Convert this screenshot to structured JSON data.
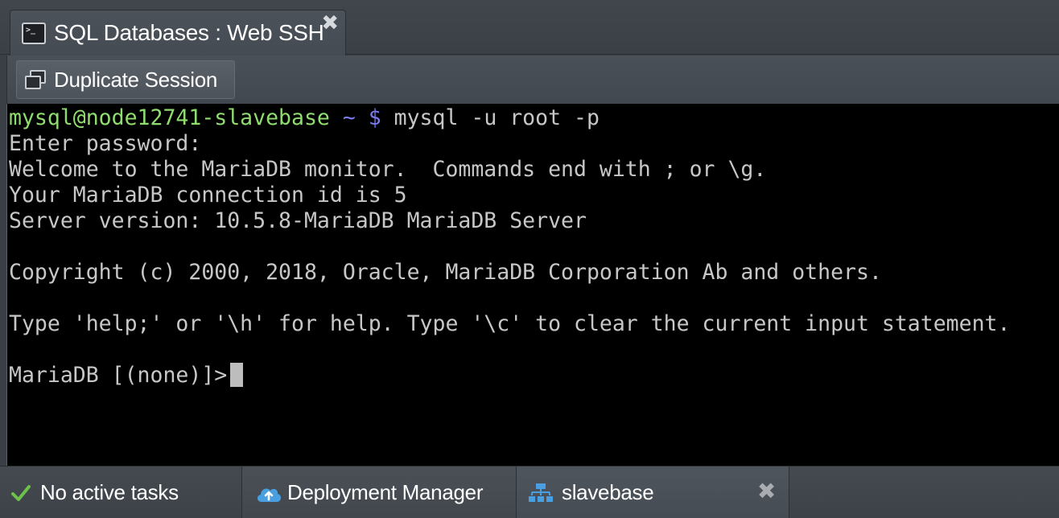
{
  "tab": {
    "title": "SQL Databases : Web SSH",
    "icon": "terminal-icon",
    "icon_glyph": ">_",
    "close_glyph": "✖"
  },
  "toolbar": {
    "duplicate_label": "Duplicate Session",
    "duplicate_icon": "duplicate-window-icon"
  },
  "terminal": {
    "prompt_user": "mysql@node12741-slavebase",
    "prompt_path": " ~ $",
    "command": " mysql -u root -p",
    "lines": [
      "Enter password:",
      "Welcome to the MariaDB monitor.  Commands end with ; or \\g.",
      "Your MariaDB connection id is 5",
      "Server version: 10.5.8-MariaDB MariaDB Server",
      "",
      "Copyright (c) 2000, 2018, Oracle, MariaDB Corporation Ab and others.",
      "",
      "Type 'help;' or '\\h' for help. Type '\\c' to clear the current input statement.",
      ""
    ],
    "db_prompt": "MariaDB [(none)]>",
    "colors": {
      "user": "#8fdc6f",
      "path": "#7c7cf0",
      "text": "#c7c7c7",
      "background": "#000000"
    }
  },
  "statusbar": {
    "tasks_label": "No active tasks",
    "tasks_icon": "check-icon",
    "deployment_label": "Deployment Manager",
    "deployment_icon": "cloud-upload-icon",
    "node_label": "slavebase",
    "node_icon": "environment-tree-icon",
    "close_glyph": "✖"
  },
  "colors": {
    "check": "#6cc24a",
    "cloud": "#4a9fe0",
    "tree": "#4a9fe0"
  }
}
